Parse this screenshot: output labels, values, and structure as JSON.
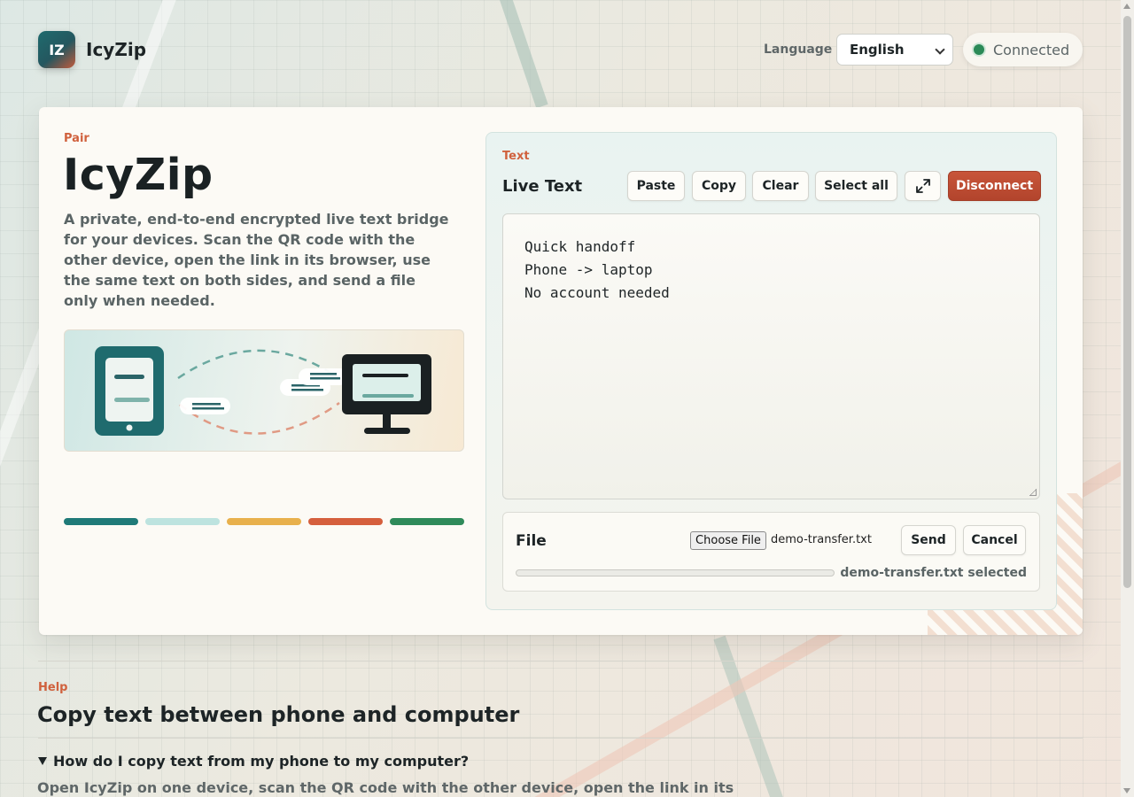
{
  "header": {
    "logo_text": "IZ",
    "brand": "IcyZip",
    "language_label": "Language",
    "language_selected": "English",
    "status_text": "Connected"
  },
  "hero": {
    "eyebrow": "Pair",
    "title": "IcyZip",
    "description": "A private, end-to-end encrypted live text bridge for your devices. Scan the QR code with the other device, open the link in its browser, use the same text on both sides, and send a file only when needed."
  },
  "palette": [
    "#1f7a78",
    "#bde3df",
    "#e8b04c",
    "#d55f3d",
    "#2f8a5a"
  ],
  "panel": {
    "eyebrow": "Text",
    "title": "Live Text",
    "buttons": {
      "paste": "Paste",
      "copy": "Copy",
      "clear": "Clear",
      "select_all": "Select all",
      "disconnect": "Disconnect"
    },
    "text_lines": [
      "Quick handoff",
      "Phone -> laptop",
      "No account needed"
    ]
  },
  "file": {
    "title": "File",
    "choose_label": "Choose File",
    "chosen_name": "demo-transfer.txt",
    "send": "Send",
    "cancel": "Cancel",
    "progress": 0,
    "status": "demo-transfer.txt selected"
  },
  "help": {
    "eyebrow": "Help",
    "title": "Copy text between phone and computer",
    "question": "How do I copy text from my phone to my computer?",
    "answer": "Open IcyZip on one device, scan the QR code with the other device, open the link in its"
  },
  "colors": {
    "accent": "#d0613d",
    "teal": "#1f6b6e",
    "disconnect": "#b9472f",
    "status_dot": "#2b8a57"
  }
}
